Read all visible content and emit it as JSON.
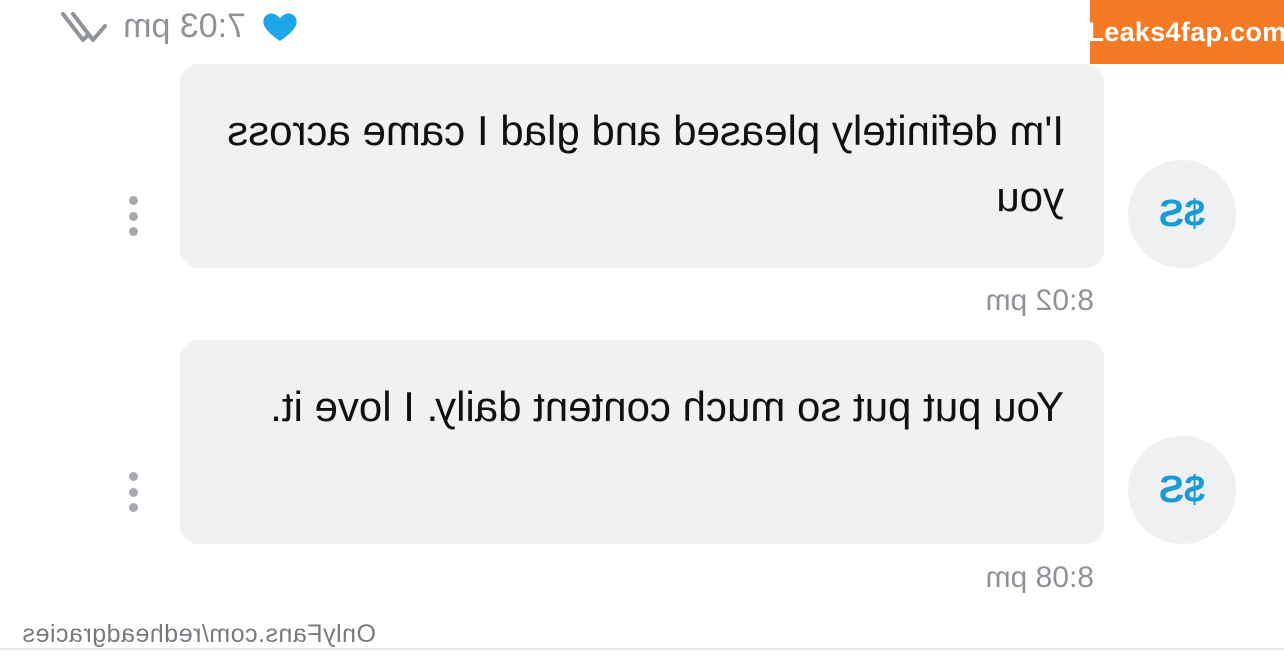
{
  "watermark": {
    "site": "Leaks4fap.com",
    "bg_color": "#f47a25"
  },
  "status": {
    "time": "7:03 pm",
    "read_icon": "double-check-icon",
    "reaction_icon": "heart-icon",
    "reaction_color": "#1fa6e8"
  },
  "messages": [
    {
      "text": "I'm definitely pleased and glad I came across you",
      "avatar": "$S",
      "time": "8:02 pm"
    },
    {
      "text": "You put put so much content daily. I love it.",
      "avatar": "$S",
      "time": "8:08 pm"
    }
  ],
  "footer": {
    "source": "OnlyFans.com/redheadgracies"
  },
  "colors": {
    "avatar_text": "#1a9ad6",
    "bubble_bg": "#f0f1f3"
  }
}
